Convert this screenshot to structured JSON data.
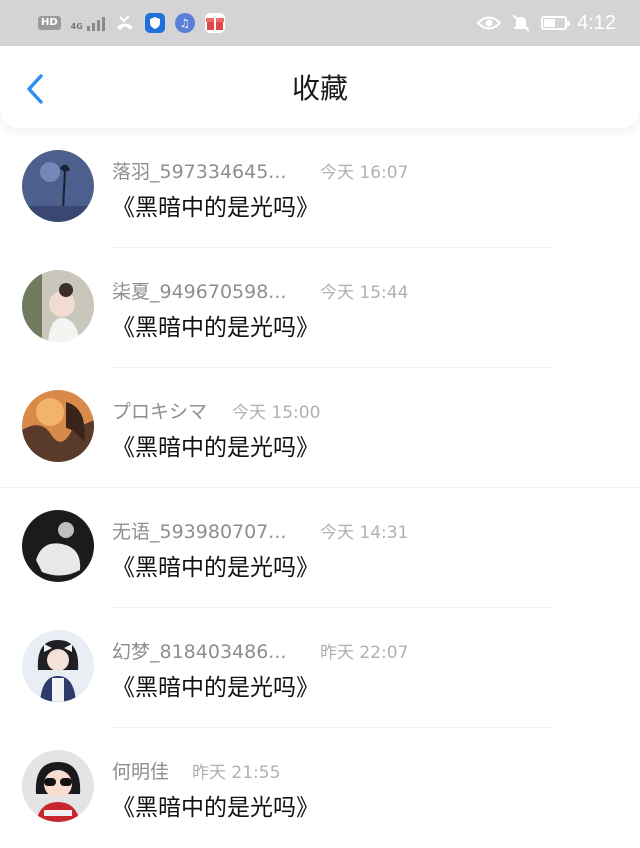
{
  "status_bar": {
    "hd_label": "HD",
    "network_label": "4G",
    "time": "4:12",
    "battery_level": 0.55,
    "icons": [
      "hd-icon",
      "signal-icon",
      "missed-call-icon",
      "shield-app-icon",
      "music-app-icon",
      "gift-app-icon",
      "eye-icon",
      "mute-bell-icon",
      "battery-icon"
    ]
  },
  "nav": {
    "title": "收藏",
    "back_icon": "chevron-left-icon",
    "accent": "#2f8ff0"
  },
  "items": [
    {
      "name": "落羽_597334645...",
      "time": "今天 16:07",
      "content": "《黑暗中的是光吗》",
      "avatar": "avatar-dark-blue"
    },
    {
      "name": "柒夏_949670598...",
      "time": "今天 15:44",
      "content": "《黑暗中的是光吗》",
      "avatar": "avatar-girl-bun"
    },
    {
      "name": "プロキシマ",
      "time": "今天 15:00",
      "content": "《黑暗中的是光吗》",
      "avatar": "avatar-orange-sunset"
    },
    {
      "name": "无语_593980707...",
      "time": "今天 14:31",
      "content": "《黑暗中的是光吗》",
      "avatar": "avatar-black-white"
    },
    {
      "name": "幻梦_818403486...",
      "time": "昨天 22:07",
      "content": "《黑暗中的是光吗》",
      "avatar": "avatar-girl-bow"
    },
    {
      "name": "何明佳",
      "time": "昨天 21:55",
      "content": "《黑暗中的是光吗》",
      "avatar": "avatar-kid-sunglasses"
    }
  ]
}
